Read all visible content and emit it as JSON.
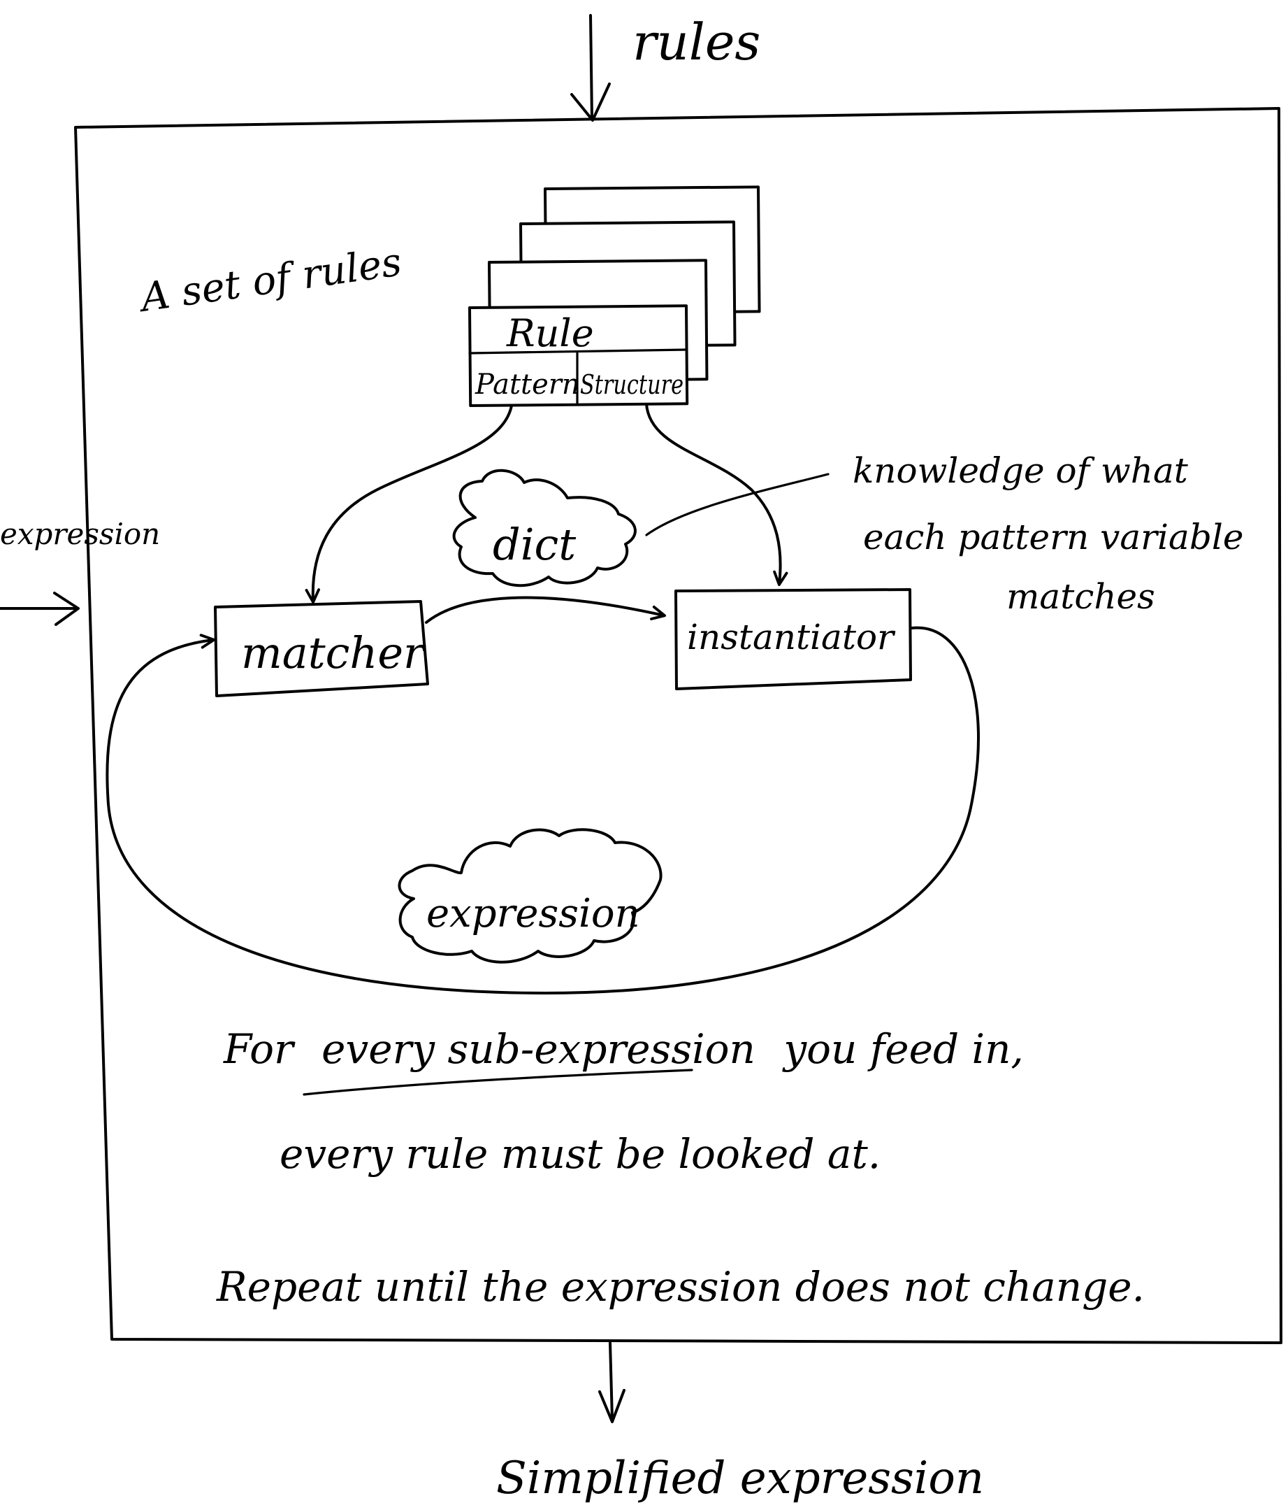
{
  "diagram": {
    "inputs": {
      "rules_label": "rules",
      "expression_in_label": "expression"
    },
    "output": {
      "label": "Simplified expression"
    },
    "rule_set": {
      "label": "A set of rules",
      "card_title": "Rule",
      "card_field_left": "Pattern",
      "card_field_right": "Structure"
    },
    "components": {
      "matcher": "matcher",
      "instantiator": "instantiator",
      "dict": "dict",
      "expression_cloud": "expression"
    },
    "annotation": {
      "line1": "knowledge of what",
      "line2": "each pattern variable",
      "line3": "matches"
    },
    "notes": {
      "line1_prefix": "For",
      "line1_underlined": "every sub-expression",
      "line1_suffix": "you feed in,",
      "line2": "every rule must be looked at.",
      "line3": "Repeat until the expression does not change."
    }
  }
}
